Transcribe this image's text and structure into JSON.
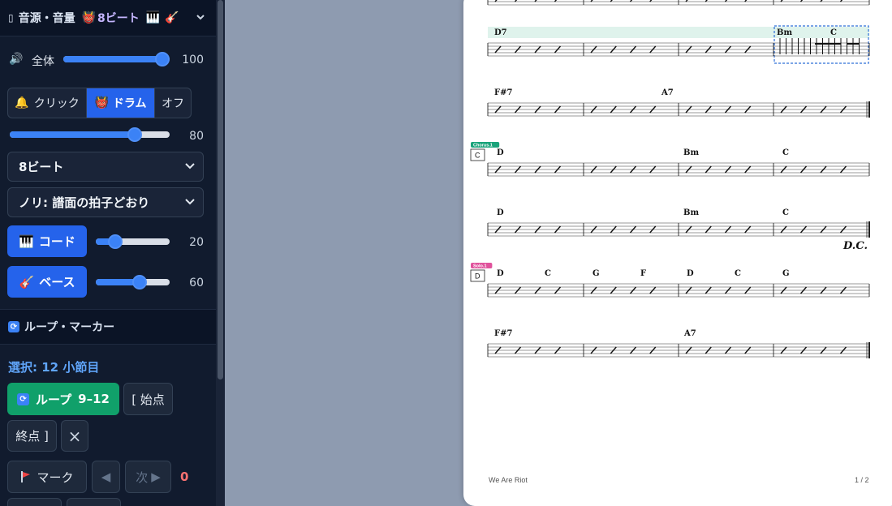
{
  "sidebar": {
    "audio_section": {
      "title": "音源・音量",
      "drum_badge": "8ビート"
    },
    "master": {
      "label": "全体",
      "value": "100",
      "level": 1.0
    },
    "metronome": {
      "click_label": "クリック",
      "drum_label": "ドラム",
      "off_label": "オフ",
      "volume": "80",
      "level": 0.8
    },
    "pattern_select": {
      "value": "8ビート"
    },
    "feel_select": {
      "value": "ノリ: 譜面の拍子どおり"
    },
    "chord_button": {
      "label": "コード",
      "volume": "20",
      "level": 0.2
    },
    "bass_button": {
      "label": "ベース",
      "volume": "60",
      "level": 0.6
    },
    "loop_section": {
      "title": "ループ・マーカー"
    },
    "selection_text": "選択: 12 小節目",
    "loop_button": {
      "label": "ループ",
      "range": "9–12"
    },
    "start_button": "[ 始点",
    "end_button": "終点 ]",
    "mark_button": "マーク",
    "next_button": "次",
    "marker_count": "0"
  },
  "score": {
    "rows": [
      {
        "chords": []
      },
      {
        "chords": [
          "D7",
          "Bm",
          "C"
        ]
      },
      {
        "chords": [
          "F#7",
          "A7"
        ]
      },
      {
        "rehearsal": "C",
        "section_tag": "Chorus.1",
        "chords": [
          "D",
          "Bm",
          "C"
        ]
      },
      {
        "chords": [
          "D",
          "Bm",
          "C"
        ],
        "end_mark": "D.C."
      },
      {
        "rehearsal": "D",
        "section_tag": "Solo.1",
        "chords": [
          "D",
          "C",
          "G",
          "F",
          "D",
          "C",
          "G"
        ]
      },
      {
        "chords": [
          "F#7",
          "A7"
        ]
      }
    ],
    "footer_title": "We Are Riot",
    "page_number": "1 / 2"
  },
  "colors": {
    "accent": "#2563eb",
    "loop_green": "#10a06a",
    "loop_highlight": "#dff3ec",
    "chorus_tag": "#1aa37a",
    "solo_tag": "#e0529c"
  }
}
